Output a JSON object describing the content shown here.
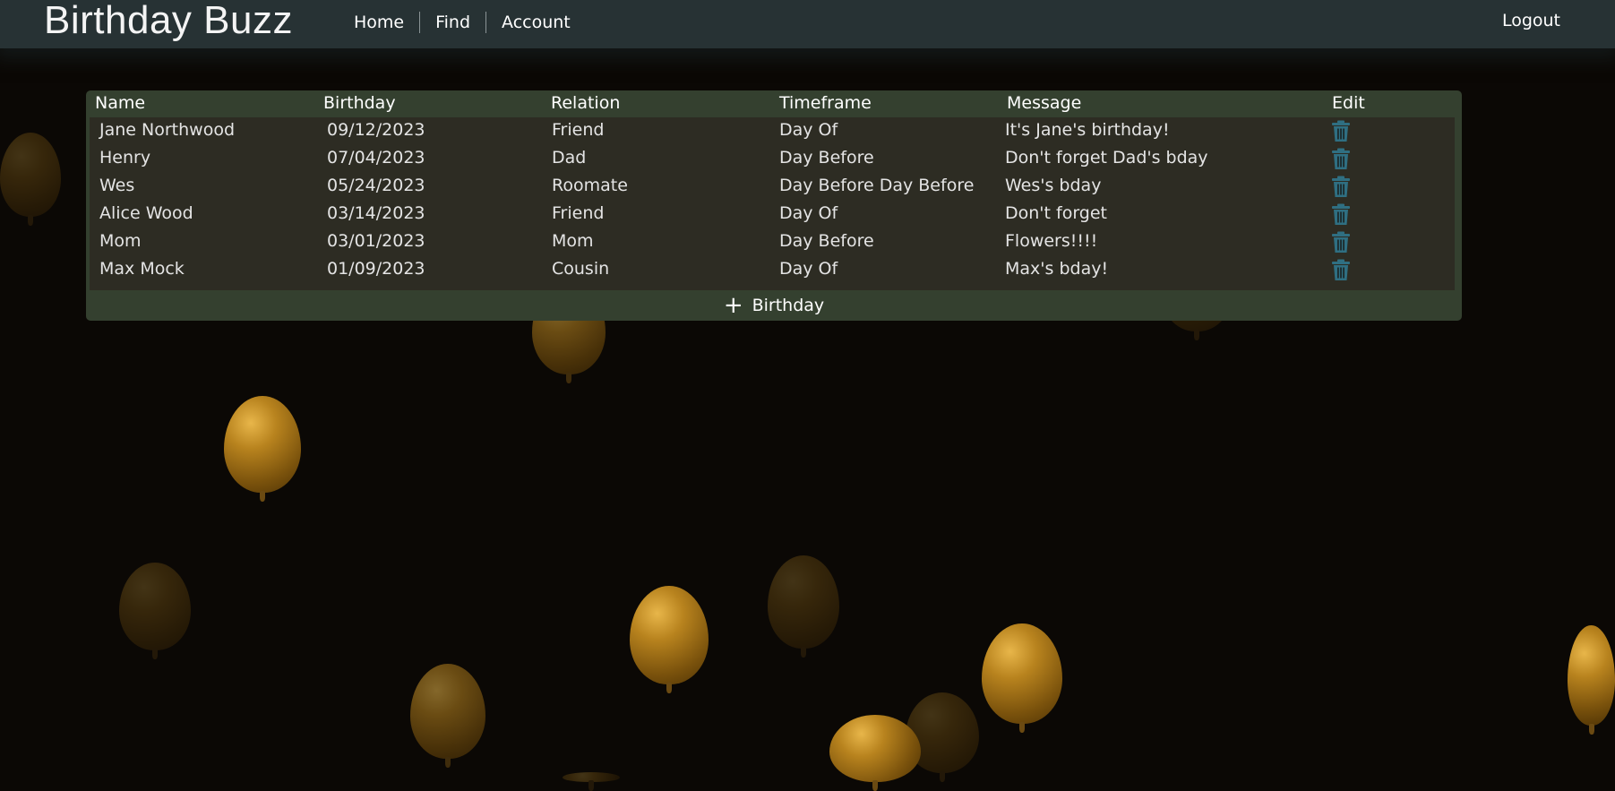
{
  "app": {
    "title": "Birthday Buzz"
  },
  "nav": {
    "home": "Home",
    "find": "Find",
    "account": "Account",
    "logout": "Logout"
  },
  "table": {
    "headers": [
      "Name",
      "Birthday",
      "Relation",
      "Timeframe",
      "Message",
      "Edit"
    ],
    "rows": [
      {
        "name": "Jane Northwood",
        "birthday": "09/12/2023",
        "relation": "Friend",
        "timeframe": "Day Of",
        "message": "It's Jane's birthday!"
      },
      {
        "name": "Henry",
        "birthday": "07/04/2023",
        "relation": "Dad",
        "timeframe": "Day Before",
        "message": "Don't forget Dad's bday"
      },
      {
        "name": "Wes",
        "birthday": "05/24/2023",
        "relation": "Roomate",
        "timeframe": "Day Before Day Before",
        "message": "Wes's bday"
      },
      {
        "name": "Alice Wood",
        "birthday": "03/14/2023",
        "relation": "Friend",
        "timeframe": "Day Of",
        "message": "Don't forget"
      },
      {
        "name": "Mom",
        "birthday": "03/01/2023",
        "relation": "Mom",
        "timeframe": "Day Before",
        "message": "Flowers!!!!"
      },
      {
        "name": "Max Mock",
        "birthday": "01/09/2023",
        "relation": "Cousin",
        "timeframe": "Day Of",
        "message": "Max's bday!"
      }
    ],
    "edit_icon": "trash-icon",
    "add_label": "Birthday",
    "add_icon": "plus-icon"
  },
  "colors": {
    "navbar": "#273234",
    "panel": "#34402f",
    "trash_icon": "#2f6f82",
    "background": "#0b0805",
    "balloon": "#b8831e"
  }
}
